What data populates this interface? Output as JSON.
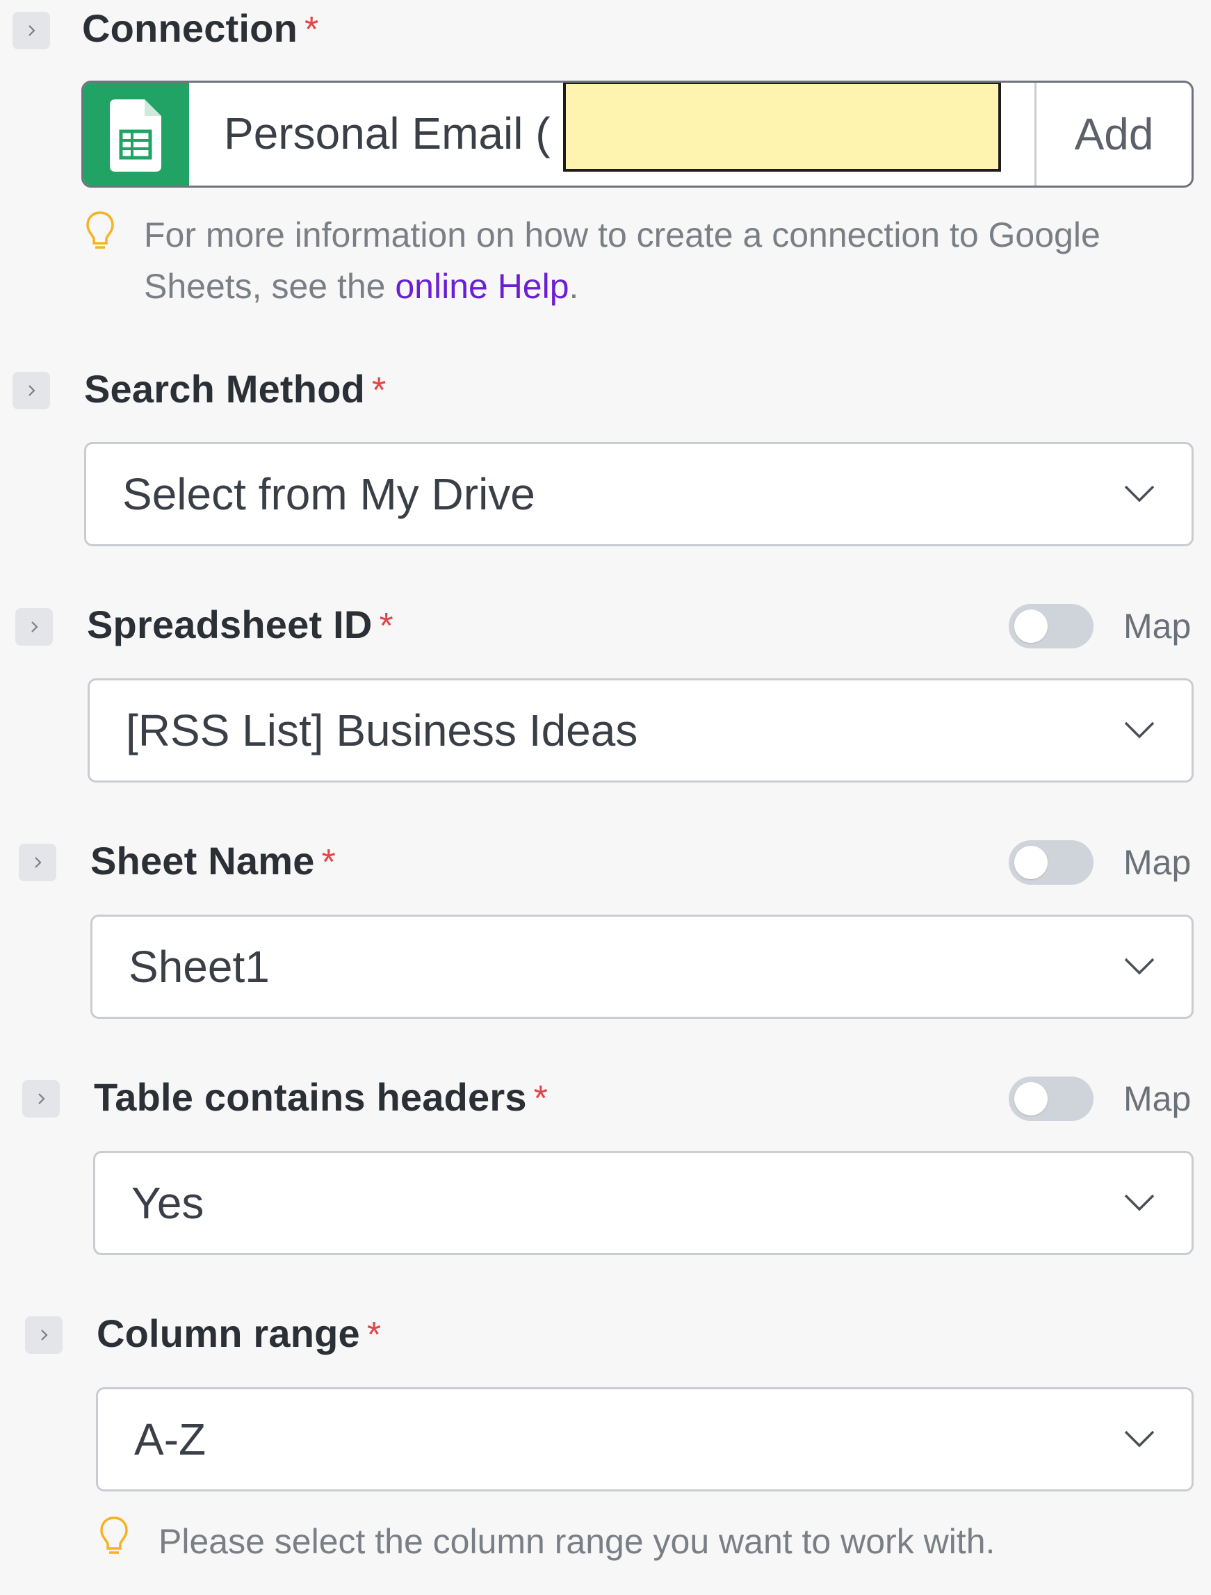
{
  "connection": {
    "label": "Connection",
    "required_mark": "*",
    "value": "Personal Email (",
    "app_icon": "google-sheets-icon",
    "brand_color": "#21a366",
    "add_label": "Add",
    "hint_text_1": "For more information on how to create a connection to Google Sheets, see the ",
    "hint_link": "online Help",
    "hint_text_2": "."
  },
  "search_method": {
    "label": "Search Method",
    "required_mark": "*",
    "value": "Select from My Drive"
  },
  "spreadsheet_id": {
    "label": "Spreadsheet ID",
    "required_mark": "*",
    "map_label": "Map",
    "value": "[RSS List] Business Ideas"
  },
  "sheet_name": {
    "label": "Sheet Name",
    "required_mark": "*",
    "map_label": "Map",
    "value": "Sheet1"
  },
  "table_headers": {
    "label": "Table contains headers",
    "required_mark": "*",
    "map_label": "Map",
    "value": "Yes"
  },
  "column_range": {
    "label": "Column range",
    "required_mark": "*",
    "value": "A-Z",
    "hint": "Please select the column range you want to work with."
  },
  "colors": {
    "required": "#e2454a",
    "link": "#6a1fd1",
    "redaction": "#fff3b0"
  }
}
